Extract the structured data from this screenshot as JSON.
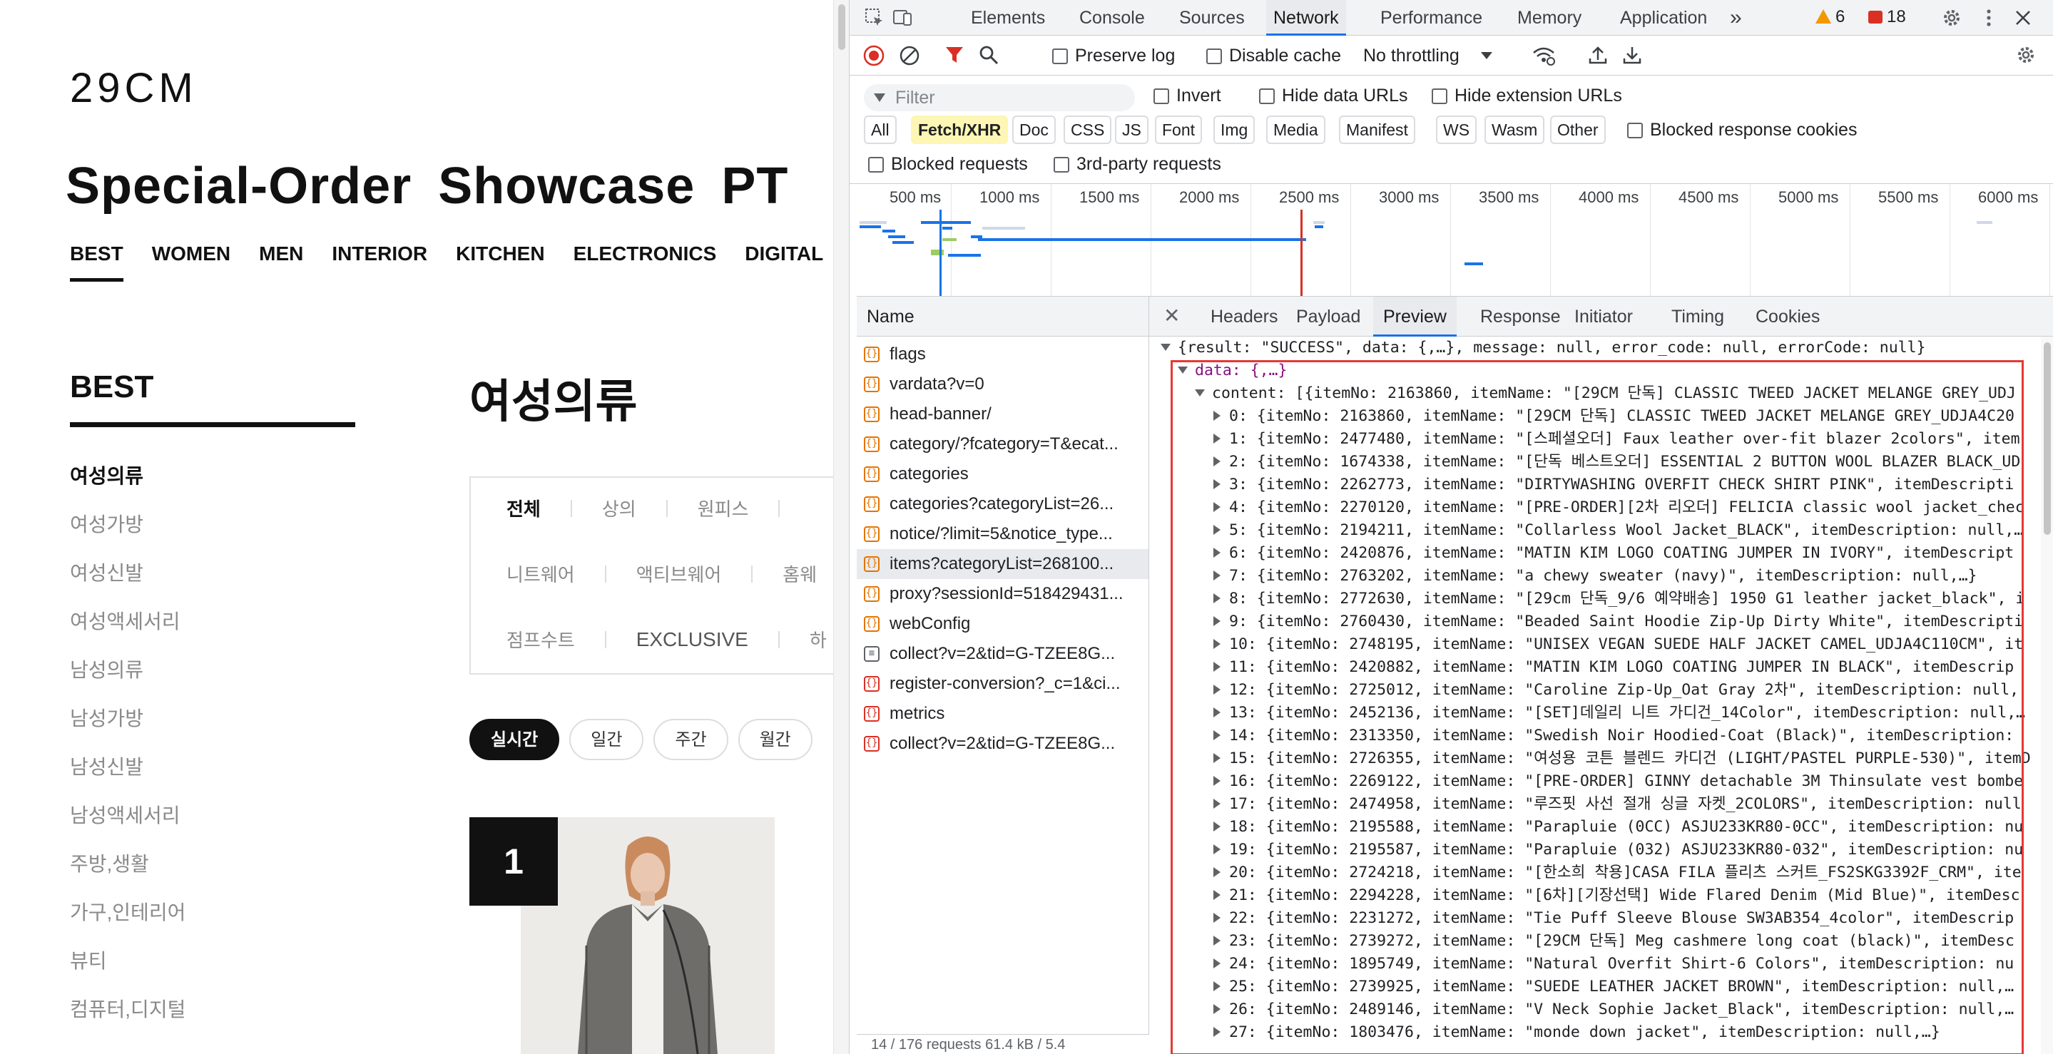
{
  "site": {
    "logo": "29CM",
    "headline": "Special-Order Showcase PT",
    "top_nav": [
      "BEST",
      "WOMEN",
      "MEN",
      "INTERIOR",
      "KITCHEN",
      "ELECTRONICS",
      "DIGITAL"
    ],
    "active_nav": "BEST",
    "side_title": "BEST",
    "side_items": [
      "여성의류",
      "여성가방",
      "여성신발",
      "여성액세서리",
      "남성의류",
      "남성가방",
      "남성신발",
      "남성액세서리",
      "주방,생활",
      "가구,인테리어",
      "뷰티",
      "컴퓨터,디지털"
    ],
    "active_side": "여성의류",
    "category_title": "여성의류",
    "filters_row1": [
      "전체",
      "상의",
      "원피스"
    ],
    "filters_row2": [
      "니트웨어",
      "액티브웨어",
      "홈웨"
    ],
    "filters_row3": [
      "점프수트",
      "EXCLUSIVE",
      "하"
    ],
    "periods": [
      "실시간",
      "일간",
      "주간",
      "월간"
    ],
    "rank": "1"
  },
  "devtools": {
    "tabs": [
      "Elements",
      "Console",
      "Sources",
      "Network",
      "Performance",
      "Memory",
      "Application"
    ],
    "active_tab": "Network",
    "more_tabs": "»",
    "warnings": "6",
    "errors": "18",
    "toolbar": {
      "preserve_log": "Preserve log",
      "disable_cache": "Disable cache",
      "throttling": "No throttling"
    },
    "filter": {
      "placeholder": "Filter",
      "invert": "Invert",
      "hide_data_urls": "Hide data URLs",
      "hide_extension_urls": "Hide extension URLs",
      "types": [
        "All",
        "Fetch/XHR",
        "Doc",
        "CSS",
        "JS",
        "Font",
        "Img",
        "Media",
        "Manifest",
        "WS",
        "Wasm",
        "Other"
      ],
      "active_type": "Fetch/XHR",
      "blocked_response_cookies": "Blocked response cookies",
      "blocked_requests": "Blocked requests",
      "third_party": "3rd-party requests"
    },
    "timeline_labels": [
      "500 ms",
      "1000 ms",
      "1500 ms",
      "2000 ms",
      "2500 ms",
      "3000 ms",
      "3500 ms",
      "4000 ms",
      "4500 ms",
      "5000 ms",
      "5500 ms",
      "6000 ms"
    ],
    "name_header": "Name",
    "requests": [
      {
        "name": "flags",
        "kind": "xhr"
      },
      {
        "name": "vardata?v=0",
        "kind": "xhr"
      },
      {
        "name": "head-banner/",
        "kind": "xhr"
      },
      {
        "name": "category/?fcategory=T&ecat...",
        "kind": "xhr"
      },
      {
        "name": "categories",
        "kind": "xhr"
      },
      {
        "name": "categories?categoryList=26...",
        "kind": "xhr"
      },
      {
        "name": "notice/?limit=5&notice_type...",
        "kind": "xhr"
      },
      {
        "name": "items?categoryList=268100...",
        "kind": "xhr",
        "selected": true
      },
      {
        "name": "proxy?sessionId=518429431...",
        "kind": "xhr"
      },
      {
        "name": "webConfig",
        "kind": "xhr"
      },
      {
        "name": "collect?v=2&tid=G-TZEE8G...",
        "kind": "doc"
      },
      {
        "name": "register-conversion?_c=1&ci...",
        "kind": "ping"
      },
      {
        "name": "metrics",
        "kind": "ping"
      },
      {
        "name": "collect?v=2&tid=G-TZEE8G...",
        "kind": "ping"
      }
    ],
    "status_bar": "14 / 176 requests   61.4 kB / 5.4",
    "detail_tabs": [
      "Headers",
      "Payload",
      "Preview",
      "Response",
      "Initiator",
      "Timing",
      "Cookies"
    ],
    "active_detail_tab": "Preview",
    "preview": {
      "root": "{result: \"SUCCESS\", data: {,…}, message: null, error_code: null, errorCode: null}",
      "data": "data: {,…}",
      "content": "content: [{itemNo: 2163860, itemName: \"[29CM 단독] CLASSIC TWEED JACKET MELANGE GREY_UDJ",
      "items": [
        "0: {itemNo: 2163860, itemName: \"[29CM 단독] CLASSIC TWEED JACKET MELANGE GREY_UDJA4C20",
        "1: {itemNo: 2477480, itemName: \"[스페셜오더] Faux leather over-fit blazer 2colors\", item",
        "2: {itemNo: 1674338, itemName: \"[단독 베스트오더] ESSENTIAL 2 BUTTON WOOL BLAZER BLACK_UD",
        "3: {itemNo: 2262773, itemName: \"DIRTYWASHING OVERFIT CHECK SHIRT PINK\", itemDescripti",
        "4: {itemNo: 2270120, itemName: \"[PRE-ORDER][2차 리오더] FELICIA classic wool jacket_chec",
        "5: {itemNo: 2194211, itemName: \"Collarless Wool Jacket_BLACK\", itemDescription: null,…",
        "6: {itemNo: 2420876, itemName: \"MATIN KIM LOGO COATING JUMPER IN IVORY\", itemDescript",
        "7: {itemNo: 2763202, itemName: \"a chewy sweater (navy)\", itemDescription: null,…}",
        "8: {itemNo: 2772630, itemName: \"[29cm 단독_9/6 예약배송] 1950 G1 leather jacket_black\", i",
        "9: {itemNo: 2760430, itemName: \"Beaded Saint Hoodie Zip-Up Dirty White\", itemDescripti",
        "10: {itemNo: 2748195, itemName: \"UNISEX VEGAN SUEDE HALF JACKET CAMEL_UDJA4C110CM\", it",
        "11: {itemNo: 2420882, itemName: \"MATIN KIM LOGO COATING JUMPER IN BLACK\", itemDescrip",
        "12: {itemNo: 2725012, itemName: \"Caroline Zip-Up_Oat Gray 2차\", itemDescription: null,",
        "13: {itemNo: 2452136, itemName: \"[SET]데일리 니트 가디건_14Color\", itemDescription: null,…",
        "14: {itemNo: 2313350, itemName: \"Swedish Noir Hoodied-Coat (Black)\", itemDescription:",
        "15: {itemNo: 2726355, itemName: \"여성용 코튼 블렌드 카디건 (LIGHT/PASTEL PURPLE-530)\", itemD",
        "16: {itemNo: 2269122, itemName: \"[PRE-ORDER] GINNY detachable 3M Thinsulate vest bombe",
        "17: {itemNo: 2474958, itemName: \"루즈핏 사선 절개 싱글 자켓_2COLORS\", itemDescription: null",
        "18: {itemNo: 2195588, itemName: \"Parapluie (0CC) ASJU233KR80-0CC\", itemDescription: nu",
        "19: {itemNo: 2195587, itemName: \"Parapluie (032) ASJU233KR80-032\", itemDescription: nu",
        "20: {itemNo: 2724218, itemName: \"[한소희 착용]CASA FILA 플리츠 스커트_FS2SKG3392F_CRM\", ite",
        "21: {itemNo: 2294228, itemName: \"[6차][기장선택] Wide Flared Denim (Mid Blue)\", itemDesc",
        "22: {itemNo: 2231272, itemName: \"Tie Puff Sleeve Blouse SW3AB354_4color\", itemDescrip",
        "23: {itemNo: 2739272, itemName: \"[29CM 단독] Meg cashmere long coat (black)\", itemDesc",
        "24: {itemNo: 1895749, itemName: \"Natural Overfit Shirt-6 Colors\", itemDescription: nu",
        "25: {itemNo: 2739925, itemName: \"SUEDE LEATHER JACKET BROWN\", itemDescription: null,…",
        "26: {itemNo: 2489146, itemName: \"V Neck Sophie Jacket_Black\", itemDescription: null,…",
        "27: {itemNo: 1803476, itemName: \"monde down jacket\", itemDescription: null,…}"
      ]
    }
  }
}
